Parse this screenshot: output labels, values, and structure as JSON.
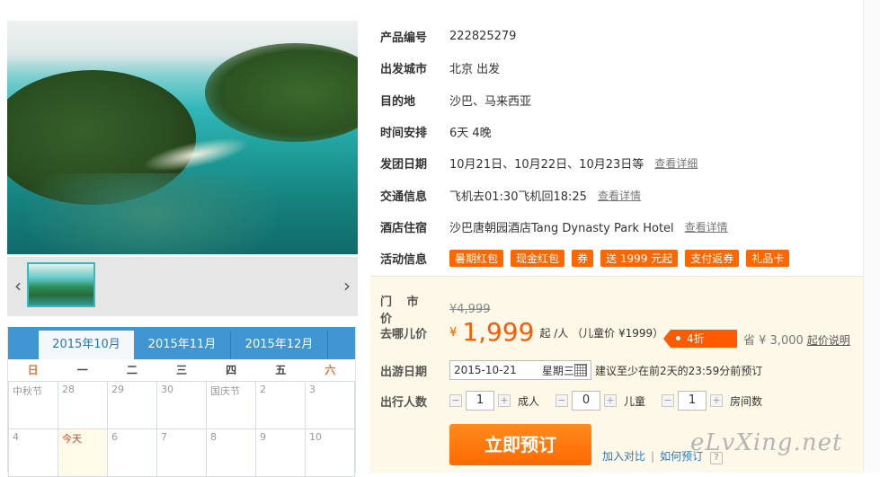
{
  "gallery": {
    "prev_icon": "chevron-left-icon",
    "next_icon": "chevron-right-icon"
  },
  "calendar": {
    "tabs": [
      {
        "label": "2015年10月",
        "active": true
      },
      {
        "label": "2015年11月",
        "active": false
      },
      {
        "label": "2015年12月",
        "active": false
      }
    ],
    "weekdays": [
      "日",
      "一",
      "二",
      "三",
      "四",
      "五",
      "六"
    ],
    "rows": [
      [
        "中秋节",
        "28",
        "29",
        "30",
        "国庆节",
        "2",
        "3"
      ],
      [
        "4",
        "今天",
        "6",
        "7",
        "8",
        "9",
        "10"
      ]
    ]
  },
  "product": {
    "rows": [
      {
        "label": "产品编号",
        "value": "222825279"
      },
      {
        "label": "出发城市",
        "value": "北京 出发"
      },
      {
        "label": "目的地",
        "value": "沙巴、马来西亚"
      },
      {
        "label": "时间安排",
        "value": "6天 4晚"
      },
      {
        "label": "发团日期",
        "value": "10月21日、10月22日、10月23日等",
        "link": "查看详细"
      },
      {
        "label": "交通信息",
        "value": "飞机去01:30飞机回18:25",
        "link": "查看详情"
      },
      {
        "label": "酒店住宿",
        "value": "沙巴唐朝园酒店Tang Dynasty Park Hotel",
        "link": "查看详情"
      }
    ],
    "activity_label": "活动信息",
    "activity_tags": [
      "暑期红包",
      "现金红包",
      "券",
      "送 1999 元起",
      "支付返券",
      "礼品卡"
    ]
  },
  "pricing": {
    "door_label": "门 市 价",
    "door_price": "¥4,999",
    "qunar_label": "去哪儿价",
    "currency": "¥",
    "price": "1,999",
    "per_person": "起 /人 （儿童价 ¥1999）",
    "discount": "4折",
    "save_text": "省 ¥ 3,000",
    "save_link": "起价说明",
    "date_label": "出游日期",
    "date_value": "2015-10-21",
    "weekday_value": "星期三",
    "date_hint": "建议至少在前2天的23:59分前预订",
    "people_label": "出行人数",
    "adults": "1",
    "adults_label": "成人",
    "children": "0",
    "children_label": "儿童",
    "rooms": "1",
    "rooms_label": "房间数",
    "minus": "−",
    "plus": "+",
    "book_label": "立即预订",
    "compare_link": "加入对比",
    "howto_link": "如何预订",
    "help_glyph": "?"
  },
  "watermark": "eLvXing.net"
}
